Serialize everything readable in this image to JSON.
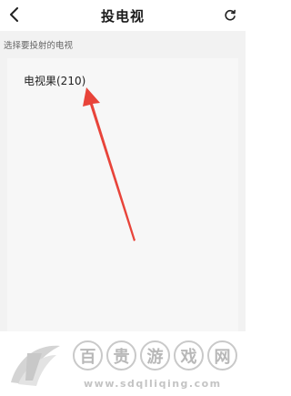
{
  "header": {
    "title": "投电视"
  },
  "main": {
    "hint": "选择要投射的电视",
    "devices": [
      {
        "label": "电视果(210)"
      }
    ]
  },
  "watermark": {
    "chars": [
      "百",
      "贵",
      "游",
      "戏",
      "网"
    ],
    "url": "www.sdqlliqing.com"
  },
  "colors": {
    "arrow": "#e8443a",
    "background": "#f2f2f2",
    "watermark": "#c4c4c4"
  },
  "icons": {
    "back": "chevron-left-icon",
    "refresh": "refresh-icon",
    "annotation": "red-arrow-icon"
  }
}
